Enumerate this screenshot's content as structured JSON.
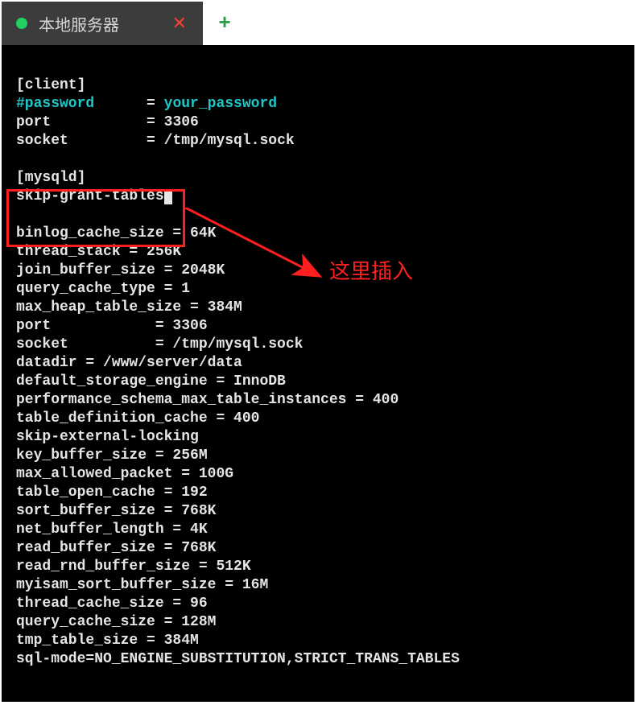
{
  "tab": {
    "title": "本地服务器",
    "close_glyph": "✕",
    "newtab_glyph": "+"
  },
  "annotation": {
    "text": "这里插入"
  },
  "config": {
    "client_header": "[client]",
    "password_key": "#password",
    "password_val": "your_password",
    "port_key": "port",
    "port_val": "3306",
    "socket_key": "socket",
    "socket_val": "/tmp/mysql.sock",
    "mysqld_header": "[mysqld]",
    "skip_grant": "skip-grant-tables",
    "lines": {
      "binlog_cache_size": "binlog_cache_size = 64K",
      "thread_stack": "thread_stack = 256K",
      "join_buffer_size": "join_buffer_size = 2048K",
      "query_cache_type": "query_cache_type = 1",
      "max_heap_table_size": "max_heap_table_size = 384M",
      "port2": "port            = 3306",
      "socket2": "socket          = /tmp/mysql.sock",
      "datadir": "datadir = /www/server/data",
      "default_storage_engine": "default_storage_engine = InnoDB",
      "performance_schema": "performance_schema_max_table_instances = 400",
      "table_definition_cache": "table_definition_cache = 400",
      "skip_external_locking": "skip-external-locking",
      "key_buffer_size": "key_buffer_size = 256M",
      "max_allowed_packet": "max_allowed_packet = 100G",
      "table_open_cache": "table_open_cache = 192",
      "sort_buffer_size": "sort_buffer_size = 768K",
      "net_buffer_length": "net_buffer_length = 4K",
      "read_buffer_size": "read_buffer_size = 768K",
      "read_rnd_buffer_size": "read_rnd_buffer_size = 512K",
      "myisam_sort_buffer_size": "myisam_sort_buffer_size = 16M",
      "thread_cache_size": "thread_cache_size = 96",
      "query_cache_size": "query_cache_size = 128M",
      "tmp_table_size": "tmp_table_size = 384M",
      "sql_mode": "sql-mode=NO_ENGINE_SUBSTITUTION,STRICT_TRANS_TABLES"
    }
  }
}
